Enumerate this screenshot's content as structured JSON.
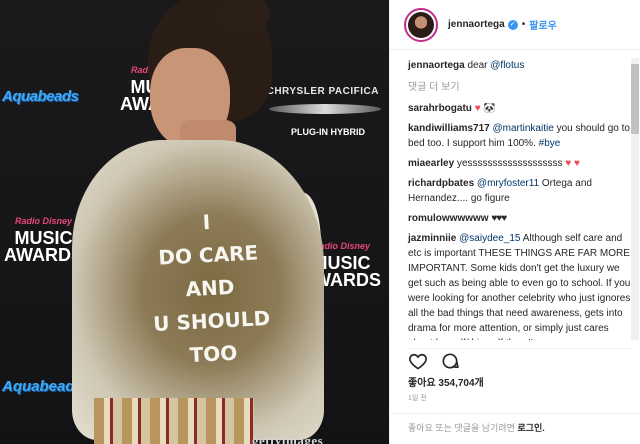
{
  "photo": {
    "backdrop_logos": {
      "aquabeads": "Aquabeads",
      "music_awards": [
        "MUSIC",
        "AWARDS"
      ],
      "disney_tag": "Radio Disney",
      "chrysler": "CHRYSLER PACIFICA",
      "plugin": "PLUG-IN HYBRID"
    },
    "jacket_text": [
      "I",
      "DO CARE",
      "AND",
      "U SHOULD",
      "TOO"
    ],
    "watermark": "gettyimages"
  },
  "header": {
    "username": "jennaortega",
    "verified_mark": "✓",
    "separator": "•",
    "follow_label": "팔로우"
  },
  "comments": [
    {
      "user": "jennaortega",
      "text": "dear",
      "mention": "@flotus"
    },
    {
      "more_label": "댓글 더 보기"
    },
    {
      "user": "sarahrbogatu",
      "text": "♥ 🐼"
    },
    {
      "user": "kandiwilliams717",
      "mention": "@martinkaitie",
      "text": "you should go to bed too. I support him 100%.",
      "tag": "#bye"
    },
    {
      "user": "miaearley",
      "text": "yesssssssssssssssssss",
      "emoji": "♥ ♥"
    },
    {
      "user": "richardpbates",
      "mention": "@mryfoster11",
      "text": "Ortega and Hernandez.... go figure"
    },
    {
      "user": "romulowwwwww",
      "emoji": "♥♥♥"
    },
    {
      "user": "jazminniie",
      "mention": "@saiydee_15",
      "text": "Although self care and etc is important THESE THINGS ARE FAR MORE IMPORTANT. Some kids don't get the luxury we get such as being able to even go to school. If you were looking for another celebrity who just ignores all the bad things that need awareness, gets into drama for more attention, or simply just cares about herself/ himself then I'm sorry"
    }
  ],
  "actions": {
    "like_icon": "heart-outline-icon",
    "comment_icon": "comment-bubble-icon"
  },
  "likes": "좋아요 354,704개",
  "timestamp": "1일 전",
  "footer": {
    "prompt": "좋아요 또는 댓글을 남기려면",
    "login": "로그인."
  },
  "colors": {
    "link": "#3897f0",
    "mention": "#003569",
    "heart": "#ed4956",
    "ring": "#c22d8b"
  }
}
